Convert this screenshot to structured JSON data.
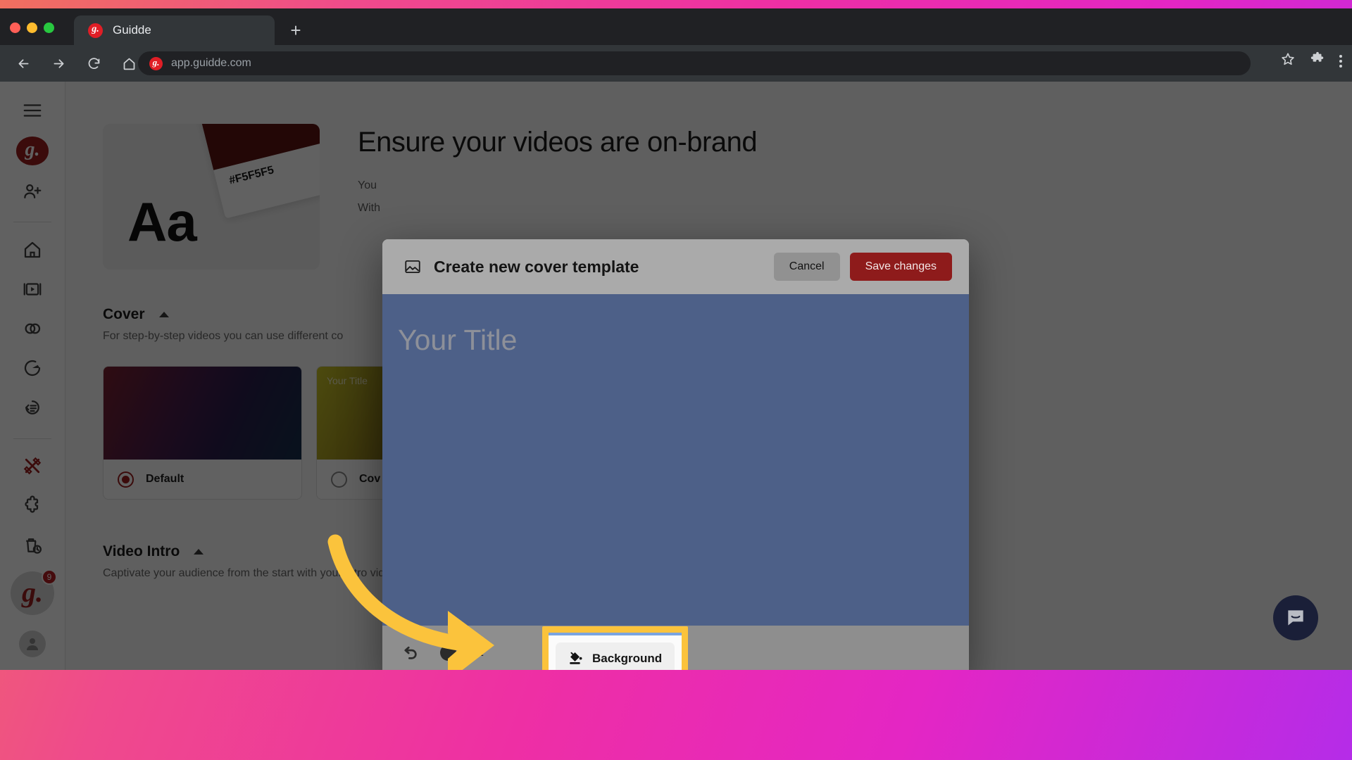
{
  "browser": {
    "tab_title": "Guidde",
    "url": "app.guidde.com",
    "new_tab_label": "+",
    "favicon_letter": "g.",
    "icons": [
      "back-arrow-icon",
      "forward-arrow-icon",
      "reload-icon",
      "home-icon",
      "bookmark-star-icon",
      "extensions-puzzle-icon",
      "browser-menu-icon"
    ]
  },
  "sidebar": {
    "logo_letter": "g.",
    "avatar_letter": "g.",
    "avatar_badge": "9",
    "items": [
      {
        "name": "menu-toggle",
        "icon": "hamburger-icon"
      },
      {
        "name": "workspace-logo",
        "icon": "guidde-logo-icon"
      },
      {
        "name": "invite-user",
        "icon": "add-user-icon"
      },
      {
        "name": "home",
        "icon": "home-icon"
      },
      {
        "name": "videos",
        "icon": "video-player-icon"
      },
      {
        "name": "spaces",
        "icon": "overlapping-circles-icon"
      },
      {
        "name": "analytics",
        "icon": "pie-chart-icon"
      },
      {
        "name": "feedback",
        "icon": "comment-history-icon"
      },
      {
        "name": "brand-kit",
        "icon": "crossed-tools-icon"
      },
      {
        "name": "extensions",
        "icon": "puzzle-icon"
      },
      {
        "name": "trash",
        "icon": "trash-clock-icon"
      }
    ]
  },
  "main": {
    "hero": {
      "title": "Ensure your videos are on-brand",
      "paragraph_line1": "You",
      "paragraph_line2": "With",
      "brand_card": {
        "typography_sample": "Aa",
        "color_hex": "#F5F5F5",
        "swatch_color": "#5C1311"
      }
    },
    "cover_section": {
      "title": "Cover",
      "subtitle": "For step-by-step videos you can use different co",
      "cards": [
        {
          "label": "Default",
          "selected": true,
          "thumb_title": ""
        },
        {
          "label": "Cov",
          "selected": false,
          "thumb_title": "Your Title"
        }
      ]
    },
    "video_intro_section": {
      "title": "Video Intro",
      "subtitle": "Captivate your audience from the start with your intro video"
    }
  },
  "modal": {
    "title": "Create new cover template",
    "header_icon": "image-icon",
    "cancel_label": "Cancel",
    "save_label": "Save changes",
    "canvas": {
      "placeholder_title": "Your Title",
      "background_color": "#4D6088"
    },
    "toolbar": {
      "undo_icon": "undo-arrow-icon",
      "insert_label": "sert"
    }
  },
  "highlight": {
    "background_button_label": "Background",
    "background_button_icon": "paint-bucket-icon",
    "highlight_color": "#FBC33C",
    "arrow_color": "#FBC33C"
  },
  "widgets": {
    "intercom_label": "intercom-chat-icon"
  },
  "colors": {
    "brand_red": "#9C1F1F",
    "save_button": "#8E1B1B",
    "canvas_blue": "#4D6088",
    "highlight_yellow": "#FBC33C"
  }
}
